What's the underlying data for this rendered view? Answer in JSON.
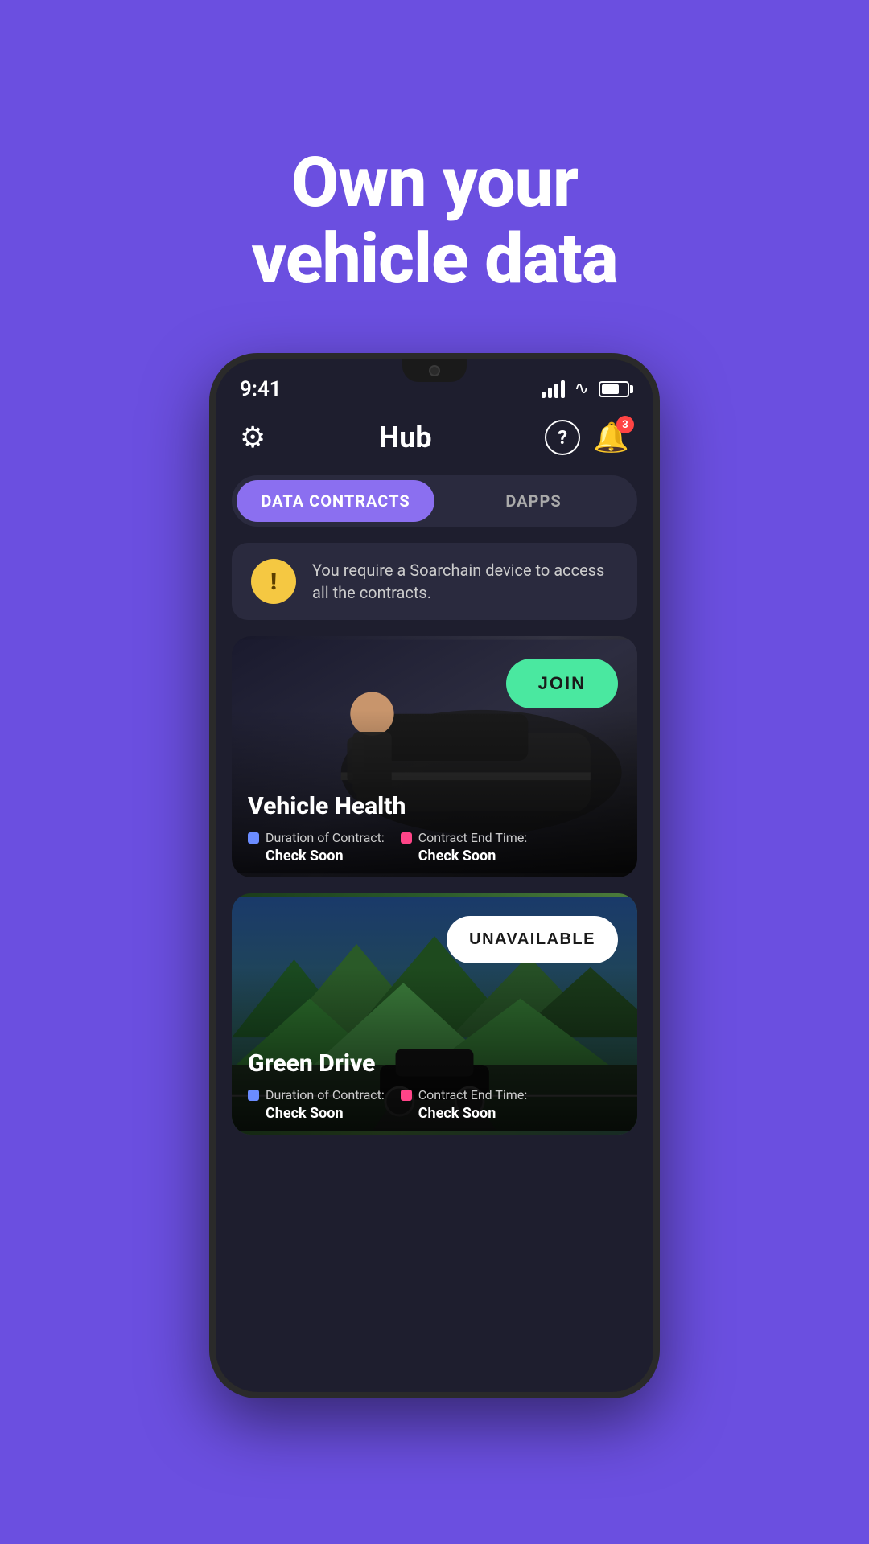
{
  "hero": {
    "title_line1": "Own your",
    "title_line2": "vehicle data"
  },
  "phone": {
    "status_bar": {
      "time": "9:41",
      "badge_count": "3"
    },
    "header": {
      "title": "Hub",
      "bell_count": "3"
    },
    "tabs": [
      {
        "id": "data-contracts",
        "label": "DATA CONTRACTS",
        "active": true
      },
      {
        "id": "dapps",
        "label": "DAPPS",
        "active": false
      }
    ],
    "warning": {
      "text": "You require a Soarchain device to access all the contracts."
    },
    "cards": [
      {
        "id": "vehicle-health",
        "title": "Vehicle Health",
        "button_label": "JOIN",
        "button_type": "join",
        "duration_label": "Duration of Contract:",
        "duration_value": "Check Soon",
        "end_time_label": "Contract End Time:",
        "end_time_value": "Check Soon"
      },
      {
        "id": "green-drive",
        "title": "Green Drive",
        "button_label": "UNAVAILABLE",
        "button_type": "unavailable",
        "duration_label": "Duration of Contract:",
        "duration_value": "Check Soon",
        "end_time_label": "Contract End Time:",
        "end_time_value": "Check Soon"
      }
    ]
  }
}
